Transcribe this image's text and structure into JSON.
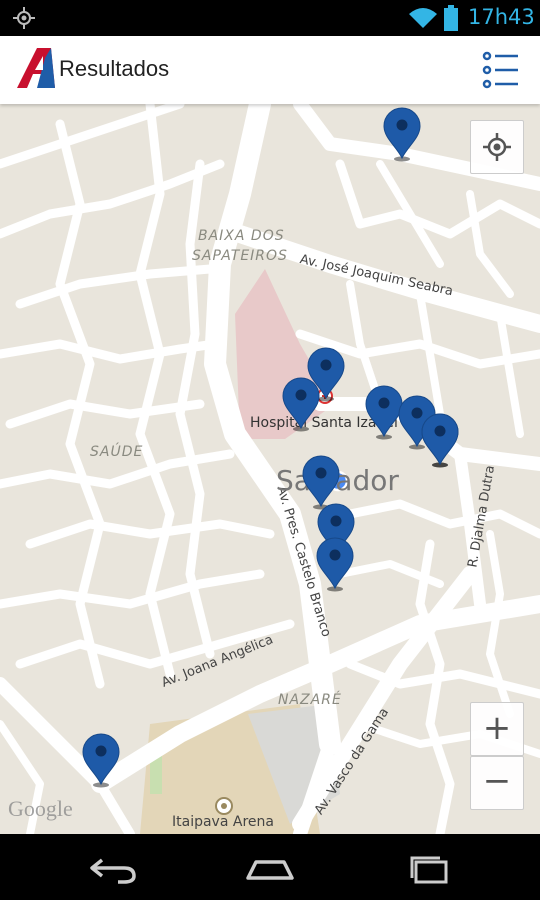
{
  "status": {
    "time": "17h43",
    "icons": [
      "gps-icon",
      "wifi-icon",
      "battery-icon"
    ],
    "accent": "#33b5e5"
  },
  "app": {
    "title": "Resultados",
    "logo": "app-logo",
    "list_icon": "list-icon",
    "accent": "#1f5da8"
  },
  "map": {
    "districts": [
      "BAIXA DOS",
      "SAPATEIROS",
      "SAÚDE",
      "NAZARÉ"
    ],
    "streets": [
      "Av. José Joaquim Seabra",
      "Av. Pres. Castelo Branco",
      "R. Djalma Dutra",
      "Av. Joana Angélica",
      "Av. Vasco da Gama"
    ],
    "places": {
      "hospital": "Hospital Santa Izabel",
      "city": "Salvador",
      "arena": "Itaipava Arena"
    },
    "attribution": "Google",
    "controls": {
      "zoom_in": "+",
      "zoom_out": "−"
    },
    "pin_color": "#1e5aa8",
    "pin_count": 11
  },
  "navbar": {
    "icons": [
      "back-icon",
      "home-icon",
      "recents-icon"
    ]
  }
}
